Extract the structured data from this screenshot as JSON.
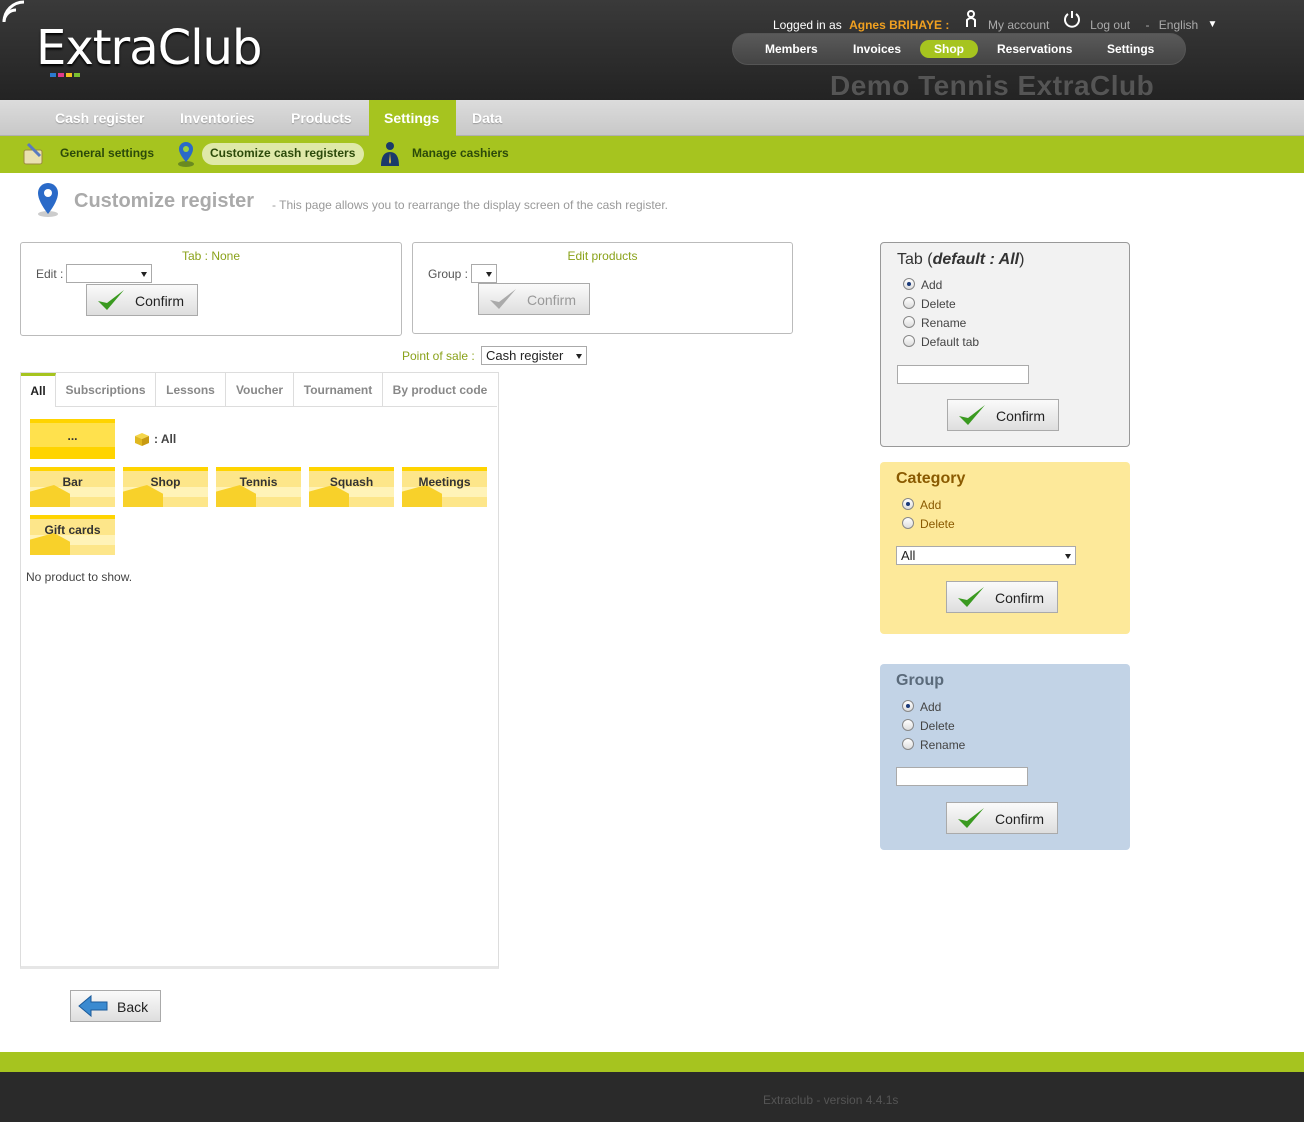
{
  "header": {
    "logo_text": "ExtraClub",
    "logged_in_prefix": "Logged in as",
    "user_name": "Agnes BRIHAYE :",
    "my_account": "My account",
    "log_out": "Log out",
    "language_sep": "-",
    "language": "English",
    "language_caret": "▼",
    "club_name": "Demo Tennis ExtraClub",
    "nav": [
      "Members",
      "Invoices",
      "Shop",
      "Reservations",
      "Settings"
    ]
  },
  "subnav": [
    "Cash register",
    "Inventories",
    "Products",
    "Settings",
    "Data"
  ],
  "greenbar": [
    "General settings",
    "Customize cash registers",
    "Manage cashiers"
  ],
  "page": {
    "title": "Customize register",
    "description": "- This page allows you to rearrange the display screen of the cash register."
  },
  "tab_box": {
    "title": "Tab : None",
    "edit_label": "Edit :",
    "edit_value": "",
    "confirm": "Confirm"
  },
  "products_box": {
    "title": "Edit products",
    "group_label": "Group :",
    "group_value": "",
    "confirm": "Confirm"
  },
  "point_of_sale": {
    "label": "Point of sale :",
    "value": "Cash register"
  },
  "register_tabs": [
    "All",
    "Subscriptions",
    "Lessons",
    "Voucher",
    "Tournament",
    "By product code"
  ],
  "tiles": {
    "dots": "...",
    "all_label": ": All",
    "categories": [
      "Bar",
      "Shop",
      "Tennis",
      "Squash",
      "Meetings",
      "Gift cards"
    ]
  },
  "no_product": "No product to show.",
  "tab_panel": {
    "title_prefix": "Tab (",
    "title_default": "default : All",
    "title_suffix": ")",
    "options": [
      "Add",
      "Delete",
      "Rename",
      "Default tab"
    ],
    "selected": "Add",
    "input_value": "",
    "confirm": "Confirm"
  },
  "category_panel": {
    "title": "Category",
    "options": [
      "Add",
      "Delete"
    ],
    "selected": "Add",
    "select_value": "All",
    "confirm": "Confirm"
  },
  "group_panel": {
    "title": "Group",
    "options": [
      "Add",
      "Delete",
      "Rename"
    ],
    "selected": "Add",
    "input_value": "",
    "confirm": "Confirm"
  },
  "back": "Back",
  "footer": "Extraclub - version 4.4.1s",
  "colors": {
    "accent_green": "#a6c41f",
    "user_orange": "#f0a020",
    "category_bg": "#fde99a",
    "group_bg": "#c2d3e6",
    "tab_panel_bg": "#f2f2f2"
  }
}
